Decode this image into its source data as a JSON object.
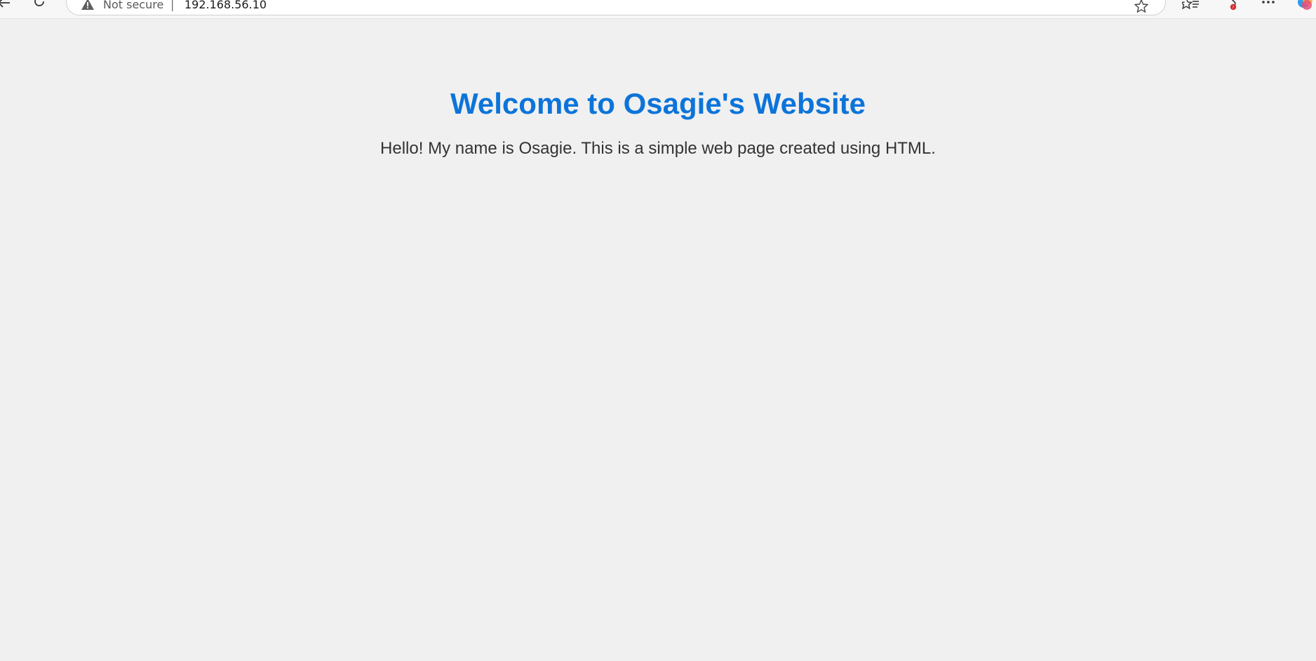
{
  "browser": {
    "security_label": "Not secure",
    "separator": "|",
    "url": "192.168.56.10",
    "icons": [
      "back-arrow-icon",
      "refresh-icon",
      "warning-icon",
      "star-icon",
      "favorites-icon",
      "extensions-icon",
      "more-icon",
      "copilot-icon"
    ]
  },
  "page": {
    "heading": "Welcome to Osagie's Website",
    "paragraph": "Hello! My name is Osagie. This is a simple web page created using HTML.",
    "heading_color": "#0c74d9",
    "background_color": "#f0f0f0",
    "text_color": "#333333"
  }
}
